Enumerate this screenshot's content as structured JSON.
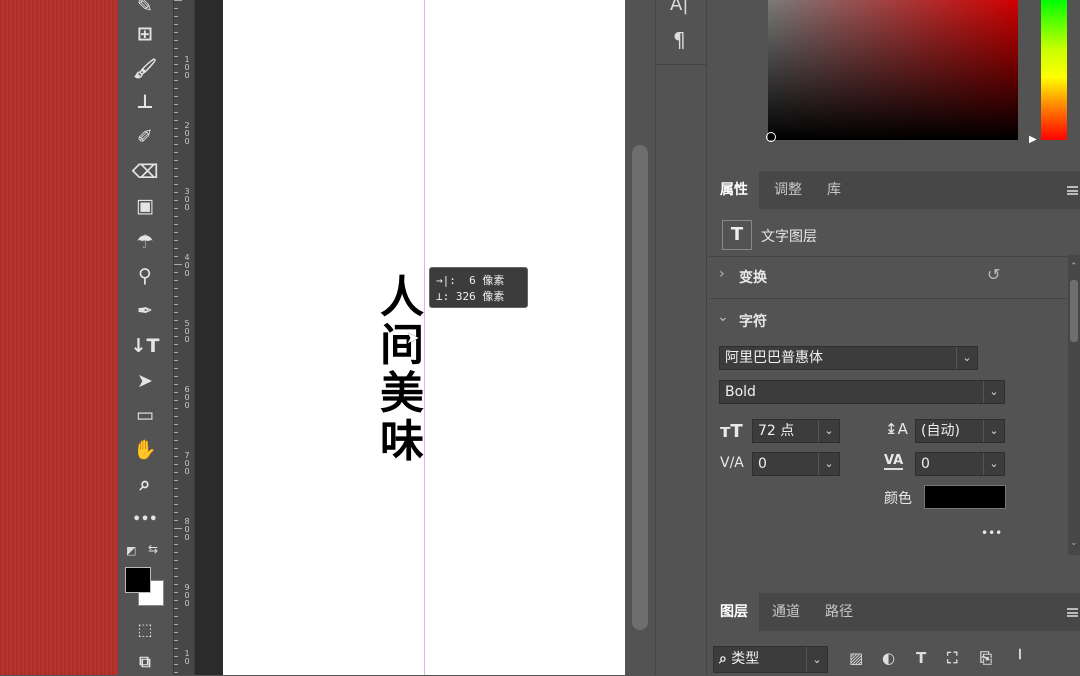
{
  "toolbar": {
    "tools": [
      {
        "icon": "pencil-icon",
        "glyph": "✎"
      },
      {
        "icon": "stamp-pattern-icon",
        "glyph": "⊞"
      },
      {
        "icon": "brush-icon",
        "glyph": "🖌"
      },
      {
        "icon": "clone-stamp-icon",
        "glyph": "⊥"
      },
      {
        "icon": "history-brush-icon",
        "glyph": "✐"
      },
      {
        "icon": "eraser-icon",
        "glyph": "⌫"
      },
      {
        "icon": "gradient-icon",
        "glyph": "▣"
      },
      {
        "icon": "blur-icon",
        "glyph": "☂"
      },
      {
        "icon": "dodge-icon",
        "glyph": "⚲"
      },
      {
        "icon": "pen-icon",
        "glyph": "✒"
      },
      {
        "icon": "vertical-type-icon",
        "glyph": "↓T"
      },
      {
        "icon": "path-selection-icon",
        "glyph": "➤"
      },
      {
        "icon": "rectangle-icon",
        "glyph": "▭"
      },
      {
        "icon": "hand-icon",
        "glyph": "✋"
      },
      {
        "icon": "zoom-icon",
        "glyph": "⌕"
      },
      {
        "icon": "more-tools-icon",
        "glyph": "•••"
      }
    ],
    "foreground_color": "#000000",
    "background_color": "#ffffff"
  },
  "ruler": {
    "labels": [
      "1\n0\n0",
      "2\n0\n0",
      "3\n0\n0",
      "4\n0\n0",
      "5\n0\n0",
      "6\n0\n0",
      "7\n0\n0",
      "8\n0\n0",
      "9\n0\n0",
      "1\n0"
    ]
  },
  "canvas": {
    "text_chars": [
      "人",
      "间",
      "美",
      "味"
    ],
    "tooltip": {
      "line1": "→|:  6 像素",
      "line2": "⊥: 326 像素"
    }
  },
  "icon_strip": {
    "top": "A|",
    "para": "¶"
  },
  "properties": {
    "tabs": [
      "属性",
      "调整",
      "库"
    ],
    "layer_type": "文字图层",
    "transform_title": "变换",
    "character_title": "字符",
    "font_family": "阿里巴巴普惠体",
    "font_style": "Bold",
    "font_size": "72 点",
    "leading": "(自动)",
    "kerning": "0",
    "tracking": "0",
    "color_label": "颜色",
    "text_color": "#000000",
    "more": "•••"
  },
  "layers": {
    "tabs": [
      "图层",
      "通道",
      "路径"
    ],
    "filter_label": "类型"
  }
}
